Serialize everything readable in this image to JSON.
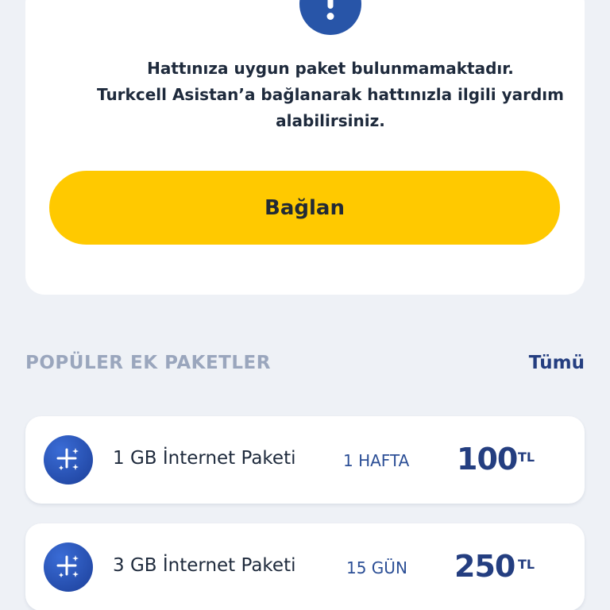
{
  "notice": {
    "icon": "exclamation-icon",
    "lines": [
      "Hattınıza uygun paket bulunmamaktadır.",
      "Turkcell Asistan’a bağlanarak hattınızla ilgili yardım",
      "alabilirsiniz."
    ],
    "button_label": "Bağlan"
  },
  "section": {
    "title": "POPÜLER EK PAKETLER",
    "see_all_label": "Tümü"
  },
  "packages": [
    {
      "icon": "sparkle-plus-icon",
      "name": "1 GB İnternet Paketi",
      "duration": "1 HAFTA",
      "price": "100",
      "currency": "TL"
    },
    {
      "icon": "sparkle-plus-icon",
      "name": "3 GB İnternet Paketi",
      "duration": "15 GÜN",
      "price": "250",
      "currency": "TL"
    }
  ],
  "colors": {
    "background": "#eef1f6",
    "accent_yellow": "#ffc900",
    "brand_blue": "#243e80",
    "icon_blue": "#2855a8",
    "section_gray": "#9aa6bd"
  }
}
